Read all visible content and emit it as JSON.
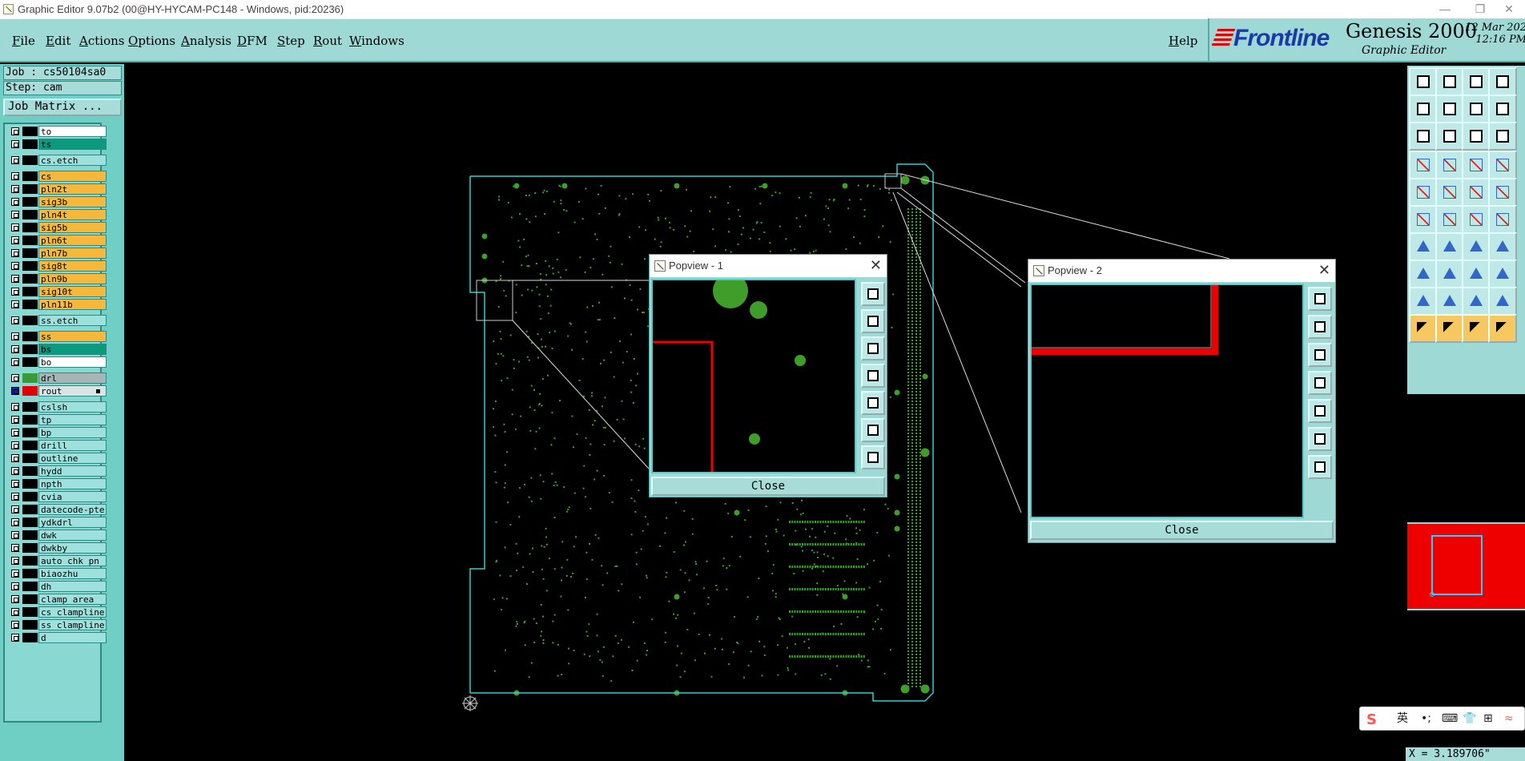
{
  "window": {
    "title": "Graphic Editor 9.07b2 (00@HY-HYCAM-PC148 - Windows, pid:20236)",
    "controls": [
      "—",
      "❐",
      "✕"
    ]
  },
  "menu": {
    "file": "File",
    "edit": "Edit",
    "actions": "Actions",
    "options": "Options",
    "analysis": "Analysis",
    "dfm": "DFM",
    "step": "Step",
    "rout": "Rout",
    "windows": "Windows",
    "help": "Help"
  },
  "brand": {
    "frontline": "Frontline",
    "genesis": "Genesis 2000",
    "graphic_editor": "Graphic Editor",
    "date": "12 Mar 202",
    "time": "12:16 PM"
  },
  "job": {
    "job_line": "Job : cs50104sa0",
    "step_line": "Step: cam",
    "matrix_button": "Job Matrix ..."
  },
  "layers": [
    {
      "name": "to",
      "color": "white"
    },
    {
      "name": "ts",
      "color": "teal"
    },
    {
      "name": "cs.etch",
      "color": "cyan",
      "gap": true
    },
    {
      "name": "cs",
      "color": "orange",
      "gap": true
    },
    {
      "name": "pln2t",
      "color": "orange"
    },
    {
      "name": "sig3b",
      "color": "orange"
    },
    {
      "name": "pln4t",
      "color": "orange"
    },
    {
      "name": "sig5b",
      "color": "orange"
    },
    {
      "name": "pln6t",
      "color": "orange"
    },
    {
      "name": "pln7b",
      "color": "orange"
    },
    {
      "name": "sig8t",
      "color": "orange"
    },
    {
      "name": "pln9b",
      "color": "orange"
    },
    {
      "name": "sig10t",
      "color": "orange"
    },
    {
      "name": "pln11b",
      "color": "orange"
    },
    {
      "name": "ss.etch",
      "color": "cyan",
      "gap": true
    },
    {
      "name": "ss",
      "color": "orange",
      "gap": true
    },
    {
      "name": "bs",
      "color": "teal"
    },
    {
      "name": "bo",
      "color": "white"
    },
    {
      "name": "drl",
      "color": "grey",
      "gap": true,
      "swatch": "#3a9a3a"
    },
    {
      "name": "rout",
      "color": "light",
      "swatch": "#e00000",
      "selected": true
    },
    {
      "name": "cslsh",
      "color": "cyan",
      "gap": true
    },
    {
      "name": "tp",
      "color": "cyan"
    },
    {
      "name": "bp",
      "color": "cyan"
    },
    {
      "name": "drill",
      "color": "cyan"
    },
    {
      "name": "outline",
      "color": "cyan"
    },
    {
      "name": "hydd",
      "color": "cyan"
    },
    {
      "name": "npth",
      "color": "cyan"
    },
    {
      "name": "cvia",
      "color": "cyan"
    },
    {
      "name": "datecode-pte",
      "color": "cyan"
    },
    {
      "name": "ydkdrl",
      "color": "cyan"
    },
    {
      "name": "dwk",
      "color": "cyan"
    },
    {
      "name": "dwkby",
      "color": "cyan"
    },
    {
      "name": "auto_chk_pn",
      "color": "cyan"
    },
    {
      "name": "biaozhu",
      "color": "cyan"
    },
    {
      "name": "dh",
      "color": "cyan"
    },
    {
      "name": "clamp_area",
      "color": "cyan"
    },
    {
      "name": "cs_clampline",
      "color": "cyan"
    },
    {
      "name": "ss_clampline",
      "color": "cyan"
    },
    {
      "name": "d",
      "color": "cyan"
    }
  ],
  "popview1": {
    "title": "Popview - 1",
    "close": "Close"
  },
  "popview2": {
    "title": "Popview - 2",
    "close": "Close"
  },
  "ime": {
    "lang": "英",
    "punct": "•;",
    "icons": [
      "keyboard",
      "skin",
      "grid",
      "more"
    ]
  },
  "coords": {
    "text": "X = 3.189706\""
  },
  "colors": {
    "panel": "#9fd9d6",
    "board_outline": "#3cc",
    "pads": "#3f9e2a",
    "rout": "#e00000"
  }
}
